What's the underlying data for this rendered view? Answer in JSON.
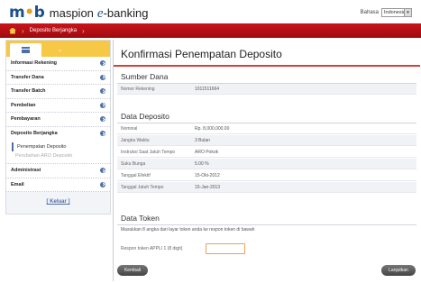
{
  "header": {
    "logo_m": "m",
    "logo_b": "b",
    "logo_brand": "maspion",
    "logo_e": "e",
    "logo_banking": "-banking",
    "lang_label": "Bahasa",
    "lang_value": "Indonesia"
  },
  "topbar": {
    "breadcrumb": "Deposito Berjangka"
  },
  "sidebar": {
    "items": [
      {
        "label": "Informasi Rekening"
      },
      {
        "label": "Transfer Dana"
      },
      {
        "label": "Transfer Batch"
      },
      {
        "label": "Pembelian"
      },
      {
        "label": "Pembayaran"
      },
      {
        "label": "Deposito Berjangka"
      }
    ],
    "subitems": [
      {
        "label": "Penempatan Deposito"
      },
      {
        "label": "Perubahan ARO Deposito"
      }
    ],
    "items2": [
      {
        "label": "Administrasi"
      },
      {
        "label": "Email"
      }
    ],
    "logout": "[ Keluar ]"
  },
  "main": {
    "title": "Konfirmasi Penempatan Deposito",
    "sumber": {
      "heading": "Sumber Dana",
      "rows": [
        {
          "k": "Nomor Rekening",
          "v": "1011511664"
        }
      ]
    },
    "deposito": {
      "heading": "Data Deposito",
      "rows": [
        {
          "k": "Nominal",
          "v": "Rp. 8,000,000.00"
        },
        {
          "k": "Jangka Waktu",
          "v": "3 Bulan"
        },
        {
          "k": "Instruksi Saat Jatuh Tempo",
          "v": "ARO Pokok"
        },
        {
          "k": "Suku Bunga",
          "v": "5.00 %"
        },
        {
          "k": "Tanggal Efektif",
          "v": "15-Okt-2012"
        },
        {
          "k": "Tanggal Jatuh Tempo",
          "v": "15-Jan-2013"
        }
      ]
    },
    "token": {
      "heading": "Data Token",
      "info": "Masukkan 8 angka dari layar token anda ke respon token di bawah",
      "label": "Respon token APPLI 1 (8 digit)",
      "value": ""
    },
    "buttons": {
      "back": "Kembali",
      "next": "Lanjutkan"
    }
  }
}
